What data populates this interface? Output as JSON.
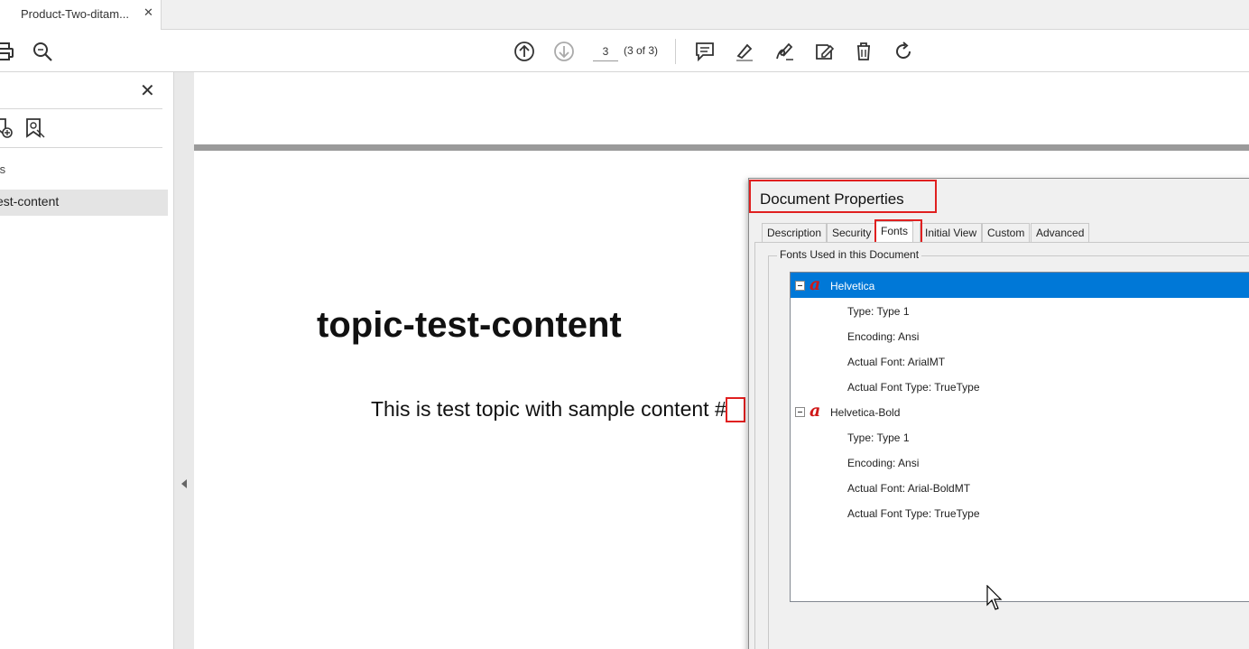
{
  "tab_strip": {
    "doc_tab_label": "Product-Two-ditam...",
    "doc_tab_close": "✕"
  },
  "toolbar": {
    "page_input_value": "3",
    "page_count": "(3 of 3)",
    "icons": [
      "print-icon",
      "zoom-icon",
      "page-up-icon",
      "page-down-icon",
      "comment-icon",
      "highlight-icon",
      "sign-icon",
      "edit-pdf-icon",
      "delete-icon",
      "rotate-icon"
    ]
  },
  "sidepanel": {
    "close_glyph": "✕",
    "heading": "ts",
    "item_label": "est-content"
  },
  "document": {
    "title": "topic-test-content",
    "body": "This is test topic with sample content #",
    "highlight_color": "#e02020"
  },
  "dialog": {
    "title": "Document Properties",
    "tabs": [
      "Description",
      "Security",
      "Fonts",
      "Initial View",
      "Custom",
      "Advanced"
    ],
    "active_tab": "Fonts",
    "group_label": "Fonts Used in this Document",
    "fonts": [
      {
        "name": "Helvetica",
        "selected": true,
        "details": [
          "Type: Type 1",
          "Encoding: Ansi",
          "Actual Font: ArialMT",
          "Actual Font Type: TrueType"
        ]
      },
      {
        "name": "Helvetica-Bold",
        "selected": false,
        "details": [
          "Type: Type 1",
          "Encoding: Ansi",
          "Actual Font: Arial-BoldMT",
          "Actual Font Type: TrueType"
        ]
      }
    ],
    "selection_color": "#0078d7"
  }
}
